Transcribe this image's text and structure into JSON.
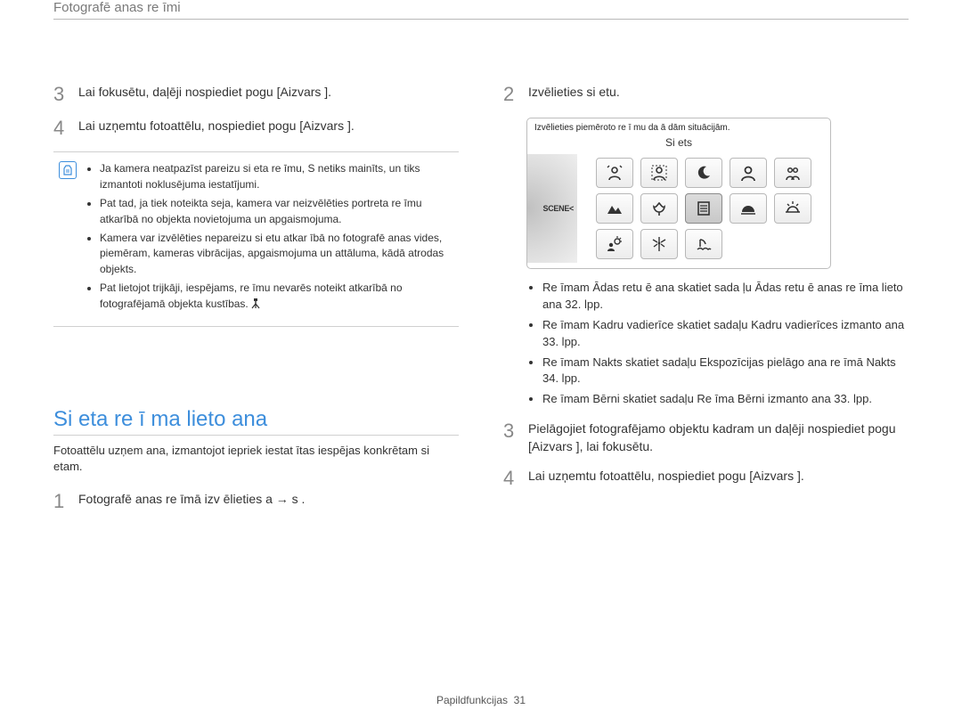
{
  "header": "Fotografē anas re   īmi",
  "left": {
    "step3": {
      "num": "3",
      "text": "Lai fokusētu, daļēji nospiediet pogu [Aizvars ]."
    },
    "step4": {
      "num": "4",
      "text": "Lai uzņemtu fotoattēlu, nospiediet pogu [Aizvars ]."
    },
    "notes": [
      "Ja kamera neatpazīst pareizu si eta re   īmu, S    netiks mainīts, un tiks izmantoti noklusējuma iestatījumi.",
      "Pat tad, ja tiek noteikta seja, kamera var neizvēlēties portreta re  īmu atkarībā no objekta novietojuma un apgaismojuma.",
      "Kamera var izvēlēties nepareizu si etu atkar ībā no fotografē anas vides, piemēram, kameras vibrācijas, apgaismojuma un attāluma, kādā atrodas objekts.",
      "Pat lietojot trijkāji, iespējams, re īmu    nevarēs noteikt atkarībā no fotografējamā objekta kustības."
    ],
    "section_title": "Si eta re ī ma lieto ana",
    "section_desc": "Fotoattēlu uzņem ana, izmantojot iepriek  iestat ītas iespējas konkrētam si etam.",
    "step1": {
      "num": "1",
      "text": "Fotografē anas re īmā izv ēlieties a     → s       ."
    }
  },
  "right": {
    "step2": {
      "num": "2",
      "text": "Izvēlieties si etu."
    },
    "device": {
      "caption": "Izvēlieties piemēroto re ī mu da ā dām situācijām.",
      "title": "Si ets",
      "scene_label": "SCENE"
    },
    "bullets": [
      "Re  īmam Ādas retu ē ana skatiet sada ļu  Ādas retu ē anas re īma lieto ana   32. lpp.",
      "Re  īmam Kadru vadierīce skatiet sadaļu  Kadru vadierīces izmanto ana   33. lpp.",
      "Re  īmam Nakts skatiet sadaļu  Ekspozīcijas pielāgo ana re īmā Nakts   34. lpp.",
      "Re  īmam Bērni skatiet sadaļu  Re  īma Bērni izmanto ana  33. lpp."
    ],
    "step3": {
      "num": "3",
      "text": "Pielāgojiet fotografējamo objektu kadram un daļēji nospiediet pogu [Aizvars ], lai fokusētu."
    },
    "step4": {
      "num": "4",
      "text": "Lai uzņemtu fotoattēlu, nospiediet pogu [Aizvars ]."
    }
  },
  "footer": {
    "label": "Papildfunkcijas",
    "page": "31"
  }
}
